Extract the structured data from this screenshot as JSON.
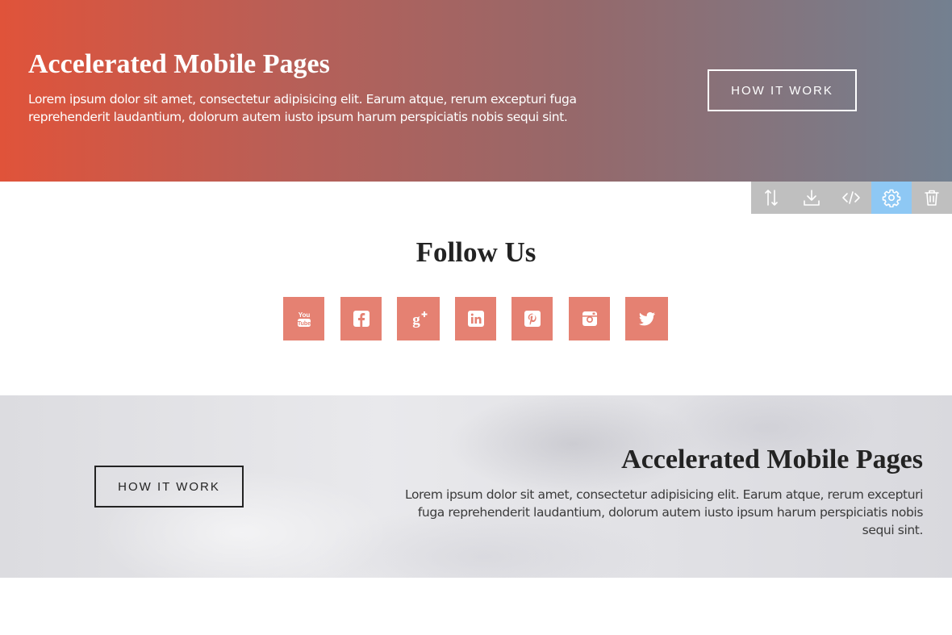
{
  "hero": {
    "title": "Accelerated Mobile Pages",
    "text": "Lorem ipsum dolor sit amet, consectetur adipisicing elit. Earum atque, rerum excepturi fuga reprehenderit laudantium, dolorum autem iusto ipsum harum perspiciatis nobis sequi sint.",
    "button_label": "HOW IT WORK"
  },
  "toolbar": {
    "items": [
      {
        "icon": "sort-arrows-icon",
        "active": false
      },
      {
        "icon": "download-icon",
        "active": false
      },
      {
        "icon": "code-icon",
        "active": false
      },
      {
        "icon": "gear-icon",
        "active": true
      },
      {
        "icon": "trash-icon",
        "active": false
      }
    ],
    "active_color": "#8ec8f4",
    "background_color": "#bfbfbf"
  },
  "follow": {
    "title": "Follow Us",
    "icon_bg_color": "#e58172",
    "networks": [
      {
        "icon": "youtube-icon"
      },
      {
        "icon": "facebook-icon"
      },
      {
        "icon": "google-plus-icon"
      },
      {
        "icon": "linkedin-icon"
      },
      {
        "icon": "pinterest-icon"
      },
      {
        "icon": "instagram-icon"
      },
      {
        "icon": "twitter-icon"
      }
    ]
  },
  "cloud_section": {
    "title": "Accelerated Mobile Pages",
    "text": "Lorem ipsum dolor sit amet, consectetur adipisicing elit. Earum atque, rerum excepturi fuga reprehenderit laudantium, dolorum autem iusto ipsum harum perspiciatis nobis sequi sint.",
    "button_label": "HOW IT WORK"
  },
  "colors": {
    "hero_gradient_start": "#e0533a",
    "hero_gradient_end": "#738090"
  }
}
